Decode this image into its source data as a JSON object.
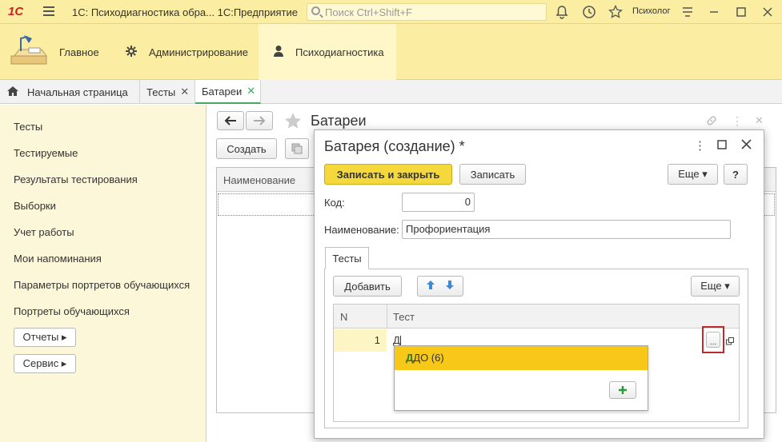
{
  "titlebar": {
    "logo": "1С",
    "title": "1С: Психодиагностика обра...  1С:Предприятие",
    "search_placeholder": "Поиск Ctrl+Shift+F",
    "user": "Психолог"
  },
  "sections": [
    {
      "label": "Главное",
      "icon": "desk-lamp-icon"
    },
    {
      "label": "Администрирование",
      "icon": "gear-icon"
    },
    {
      "label": "Психодиагностика",
      "icon": "person-icon"
    }
  ],
  "tabs": [
    {
      "label": "Начальная страница",
      "icon": "home-icon"
    },
    {
      "label": "Тесты"
    },
    {
      "label": "Батареи"
    }
  ],
  "sidebar": {
    "items": [
      "Тесты",
      "Тестируемые",
      "Результаты тестирования",
      "Выборки",
      "Учет работы",
      "Мои напоминания",
      "Параметры портретов обучающихся",
      "Портреты обучающихся"
    ],
    "reports_button": "Отчеты ▸",
    "service_button": "Сервис ▸"
  },
  "list_form": {
    "title": "Батареи",
    "create_button": "Создать",
    "column_name": "Наименование"
  },
  "dialog": {
    "title": "Батарея (создание) *",
    "save_close": "Записать и закрыть",
    "save": "Записать",
    "more": "Еще ▾",
    "help": "?",
    "code_label": "Код:",
    "code_value": "0",
    "name_label": "Наименование:",
    "name_value": "Профориентация",
    "tests_tab": "Тесты",
    "add_button": "Добавить",
    "more2": "Еще ▾",
    "col_n": "N",
    "col_test": "Тест",
    "row_n": "1",
    "row_value": "Д",
    "ellipsis": "...",
    "dropdown_item": "ДДО (6)",
    "dropdown_item_match": "Д",
    "dropdown_item_rest": "ДО (6)"
  }
}
